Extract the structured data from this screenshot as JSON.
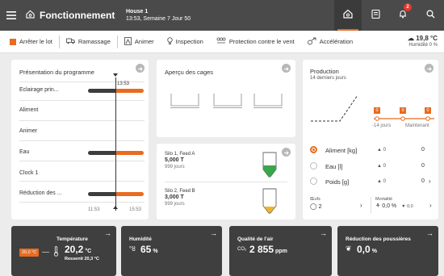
{
  "topbar": {
    "title": "Fonctionnement",
    "house_name": "House 1",
    "house_time": "13:53, Semaine 7 Jour 50",
    "notification_count": "2"
  },
  "actions": {
    "stop_batch": "Arrêter le lot",
    "pickup": "Ramassage",
    "animate": "Animer",
    "inspection": "Inspection",
    "wind_protection": "Protection contre le vent",
    "acceleration": "Accélération"
  },
  "weather": {
    "temperature": "19,8 °C",
    "humidity": "Humidité 0 %"
  },
  "program": {
    "title": "Présentation du programme",
    "current_time": "13:53",
    "rows": [
      {
        "label": "Eclairage prin...",
        "bar": true
      },
      {
        "label": "Aliment",
        "bar": false
      },
      {
        "label": "Animer",
        "bar": false
      },
      {
        "label": "Eau",
        "bar": true
      },
      {
        "label": "Clock 1",
        "bar": false
      },
      {
        "label": "Réduction des ...",
        "bar": true
      }
    ],
    "axis_start": "11:53",
    "axis_end": "15:53"
  },
  "cages": {
    "title": "Aperçu des cages"
  },
  "silos": [
    {
      "name": "Silo 1, Feed A",
      "amount": "5,000 T",
      "days": "999 jours",
      "fill": 0.35,
      "color": "#3aa64b"
    },
    {
      "name": "Silo 2, Feed B",
      "amount": "3,000 T",
      "days": "999 jours",
      "fill": 0.25,
      "color": "#f0b429"
    }
  ],
  "production": {
    "title": "Production",
    "subtitle": "14 derniers jours",
    "marker_value": "0",
    "label_14": "-14 jours",
    "label_now": "Maintenant",
    "rows": [
      {
        "label": "Aliment [kg]",
        "trend": "▲ 0",
        "value": "0",
        "selected": true
      },
      {
        "label": "Eau [l]",
        "trend": "▲ 0",
        "value": "0",
        "selected": false
      },
      {
        "label": "Poids [g]",
        "trend": "▲ 0",
        "value": "0",
        "selected": false
      }
    ],
    "eggs_label": "Œufs",
    "eggs_value": "2",
    "mortality_label": "Mortalité",
    "mortality_value": "0,0 %",
    "mortality_trend": "▼ 0,0"
  },
  "sensors": {
    "temperature": {
      "title": "Température",
      "value": "20,2",
      "unit": "°C",
      "setpoint": "20,0 °C",
      "felt": "Ressenti 20,3 °C"
    },
    "humidity": {
      "title": "Humidité",
      "value": "65",
      "unit": "%"
    },
    "air_quality": {
      "title": "Qualité de l'air",
      "prefix": "CO₂",
      "value": "2 855",
      "unit": "ppm"
    },
    "dust": {
      "title": "Réduction des poussières",
      "value": "0,0",
      "unit": "%"
    }
  },
  "colors": {
    "accent": "#e86b1f",
    "topbar": "#4a4a4a",
    "dark_card": "#3f3f3f"
  }
}
